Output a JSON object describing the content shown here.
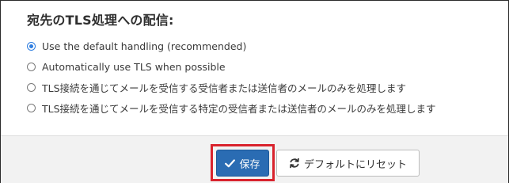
{
  "section": {
    "title": "宛先のTLS処理への配信:"
  },
  "options": [
    {
      "label": "Use the default handling (recommended)",
      "selected": true
    },
    {
      "label": "Automatically use TLS when possible",
      "selected": false
    },
    {
      "label": "TLS接続を通じてメールを受信する受信者または送信者のメールのみを処理します",
      "selected": false
    },
    {
      "label": "TLS接続を通じてメールを受信する特定の受信者または送信者のメールのみを処理します",
      "selected": false
    }
  ],
  "actions": {
    "save_label": "保存",
    "save_icon": "checkmark-icon",
    "reset_label": "デフォルトにリセット",
    "reset_icon": "refresh-icon"
  },
  "colors": {
    "primary": "#2a6cb3",
    "highlight": "#d9232d",
    "radio_selected": "#2d7de0"
  }
}
